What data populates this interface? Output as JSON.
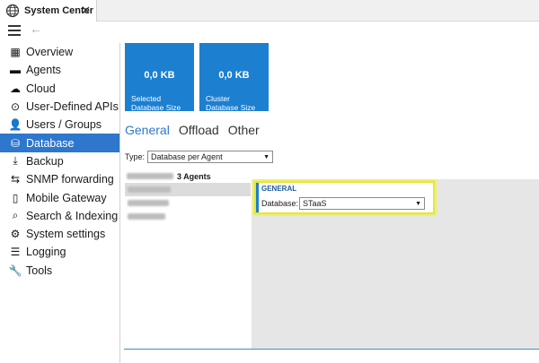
{
  "app": {
    "title": "System Center",
    "close_glyph": "✕",
    "back_glyph": "←"
  },
  "sidebar": {
    "items": [
      {
        "label": "Overview",
        "icon": "dashboard-icon",
        "glyph": "▦"
      },
      {
        "label": "Agents",
        "icon": "agents-icon",
        "glyph": "▬"
      },
      {
        "label": "Cloud",
        "icon": "cloud-icon",
        "glyph": "☁"
      },
      {
        "label": "User-Defined APIs",
        "icon": "api-icon",
        "glyph": "⊙"
      },
      {
        "label": "Users / Groups",
        "icon": "user-icon",
        "glyph": "👤"
      },
      {
        "label": "Database",
        "icon": "database-icon",
        "glyph": "⛁"
      },
      {
        "label": "Backup",
        "icon": "backup-icon",
        "glyph": "⤓"
      },
      {
        "label": "SNMP forwarding",
        "icon": "snmp-icon",
        "glyph": "⇆"
      },
      {
        "label": "Mobile Gateway",
        "icon": "mobile-icon",
        "glyph": "▯"
      },
      {
        "label": "Search & Indexing",
        "icon": "search-index-icon",
        "glyph": "⌕"
      },
      {
        "label": "System settings",
        "icon": "gear-icon",
        "glyph": "⚙"
      },
      {
        "label": "Logging",
        "icon": "list-icon",
        "glyph": "☰"
      },
      {
        "label": "Tools",
        "icon": "wrench-icon",
        "glyph": "🔧"
      }
    ],
    "active_index": 5
  },
  "tiles": [
    {
      "value": "0,0 KB",
      "label1": "Selected",
      "label2": "Database Size"
    },
    {
      "value": "0,0 KB",
      "label1": "Cluster",
      "label2": "Database Size"
    }
  ],
  "tabs": [
    "General",
    "Offload",
    "Other"
  ],
  "type_selector": {
    "label": "Type:",
    "value": "Database per Agent"
  },
  "agents": {
    "header_count": "3 Agents"
  },
  "general_group": {
    "title": "GENERAL",
    "field_label": "Database:",
    "field_value": "STaaS"
  },
  "colors": {
    "accent": "#2e77cc",
    "tile": "#1c7fd0",
    "highlight": "#e6e63a"
  }
}
